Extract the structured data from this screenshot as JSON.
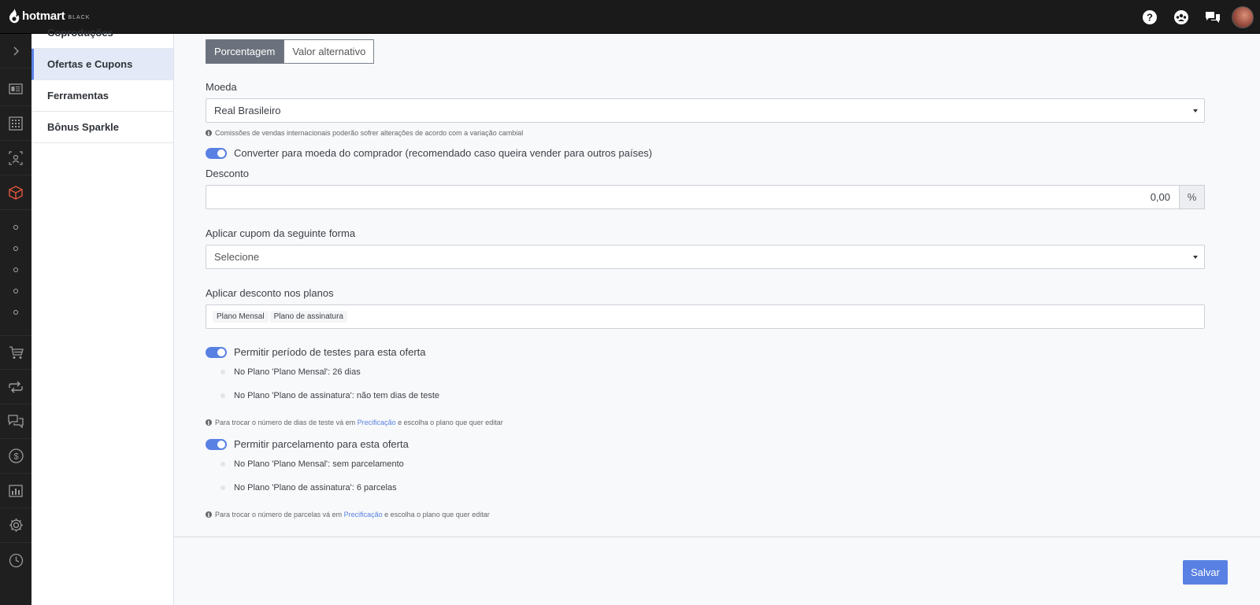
{
  "brand": {
    "name": "hotmart",
    "tier": "BLACK"
  },
  "topbar": {
    "icons": [
      "help-icon",
      "community-icon",
      "chat-icon"
    ]
  },
  "rail": {
    "icons": [
      "expand-icon",
      "dashboard-icon",
      "apps-grid-icon",
      "network-icon",
      "product-cube-icon",
      "cart-icon",
      "recurrence-icon",
      "messages-icon",
      "dollar-icon",
      "analytics-icon",
      "settings-icon"
    ]
  },
  "submenu": {
    "items": [
      {
        "label": "Coproduções"
      },
      {
        "label": "Ofertas e Cupons"
      },
      {
        "label": "Ferramentas"
      },
      {
        "label": "Bônus Sparkle"
      }
    ]
  },
  "form": {
    "mode": {
      "percent_label": "Porcentagem",
      "alt_label": "Valor alternativo"
    },
    "currency": {
      "label": "Moeda",
      "value": "Real Brasileiro",
      "hint": "Comissões de vendas internacionais poderão sofrer alterações de acordo com a variação cambial"
    },
    "convert_toggle": {
      "label": "Converter para moeda do comprador (recomendado caso queira vender para outros países)",
      "on": true
    },
    "discount": {
      "label": "Desconto",
      "value": "0,00",
      "unit": "%"
    },
    "apply_coupon": {
      "label": "Aplicar cupom da seguinte forma",
      "value": "Selecione"
    },
    "plans": {
      "label": "Aplicar desconto nos planos",
      "tags": [
        "Plano Mensal",
        "Plano de assinatura"
      ]
    },
    "trial": {
      "label": "Permitir período de testes para esta oferta",
      "on": true,
      "items": [
        "No Plano 'Plano Mensal': 26 dias",
        "No Plano 'Plano de assinatura': não tem dias de teste"
      ],
      "hint_pre": "Para trocar o número de dias de teste vá em",
      "hint_link": "Precificação",
      "hint_post": "e escolha o plano que quer editar"
    },
    "installments": {
      "label": "Permitir parcelamento para esta oferta",
      "on": true,
      "items": [
        "No Plano 'Plano Mensal': sem parcelamento",
        "No Plano 'Plano de assinatura': 6 parcelas"
      ],
      "hint_pre": "Para trocar o número de parcelas vá em",
      "hint_link": "Precificação",
      "hint_post": "e escolha o plano que quer editar"
    },
    "save_label": "Salvar"
  },
  "colors": {
    "accent": "#5981e3",
    "topbar": "#1a1a1a",
    "rail": "#1f1f1f",
    "active_item": "#e3e9f7",
    "product_icon": "#e4573d"
  }
}
